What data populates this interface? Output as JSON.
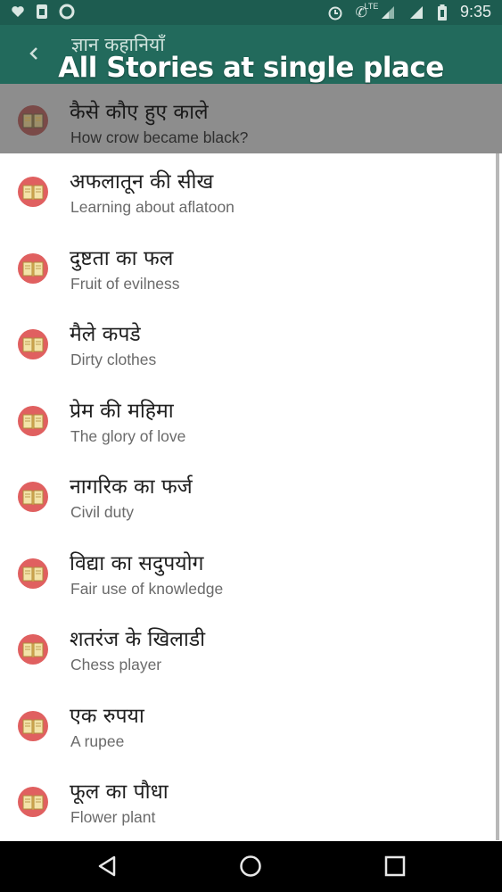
{
  "status_bar": {
    "time": "9:35",
    "network_label": "LTE",
    "left_icons": [
      "heart-icon",
      "sim-icon",
      "circle-icon"
    ],
    "right_icons": [
      "alarm-icon",
      "lte-call-icon",
      "signal-icon",
      "signal-icon",
      "battery-icon"
    ]
  },
  "app_bar": {
    "title": "ज्ञान कहानियाँ",
    "back_icon": "back-arrow-icon"
  },
  "banner": {
    "text": "All Stories at single place"
  },
  "stories": [
    {
      "title": "कैसे कौए हुए काले",
      "subtitle": "How crow became black?"
    },
    {
      "title": "अफलातून की सीख",
      "subtitle": "Learning about aflatoon"
    },
    {
      "title": "दुष्टता का फल",
      "subtitle": "Fruit of evilness"
    },
    {
      "title": "मैले कपडे",
      "subtitle": "Dirty clothes"
    },
    {
      "title": "प्रेम की महिमा",
      "subtitle": "The glory of love"
    },
    {
      "title": "नागरिक का फर्ज",
      "subtitle": "Civil duty"
    },
    {
      "title": "विद्या का सदुपयोग",
      "subtitle": "Fair use of knowledge"
    },
    {
      "title": "शतरंज के खिलाडी",
      "subtitle": "Chess player"
    },
    {
      "title": "एक रुपया",
      "subtitle": "A rupee"
    },
    {
      "title": "फूल का पौधा",
      "subtitle": "Flower plant"
    }
  ],
  "colors": {
    "primary": "#226a5c",
    "status_bar": "#1d5c50",
    "icon_circle": "#e06060",
    "book": "#f3e3a8"
  },
  "nav_bar": {
    "buttons": [
      "back-triangle-icon",
      "home-circle-icon",
      "recents-square-icon"
    ]
  }
}
